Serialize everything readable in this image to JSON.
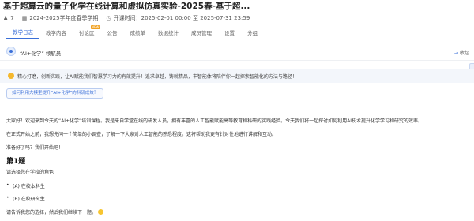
{
  "header": {
    "title": "基于超算云的量子化学在线计算和虚拟仿真实验-2025春-基于超...",
    "members": "7",
    "term": "2024-2025学年度春季学期",
    "start_label": "开课时间",
    "start": "2025-02-01 00:00",
    "to": "至",
    "end": "2025-07-31 23:59"
  },
  "tabs": [
    {
      "label": "教学日志",
      "active": true
    },
    {
      "label": "教学内容"
    },
    {
      "label": "讨论区",
      "badge": "NEW"
    },
    {
      "label": "公告"
    },
    {
      "label": "成绩单"
    },
    {
      "label": "数据统计"
    },
    {
      "label": "成员管理"
    },
    {
      "label": "设置"
    },
    {
      "label": "分组"
    }
  ],
  "assistant": {
    "name": "“AI+化学” 领航员",
    "collapse": "收起"
  },
  "welcome": "精心打磨，创新实践，让AI赋能我们智慧学习力的有效提升！追求卓越，铸就精品，丰智能体将陪伴你一起探索智能化的方法与路径！",
  "question_chip": "如何利用大模型提升“AI+化学”的科研成效？",
  "content": {
    "intro": "大家好！欢迎来到今天的“AI+化学”培训课程。我是来自学堂在线的研发人员，拥有丰富的人工智能赋能高等教育和科研的实践经验。今天我们将一起探讨如何利用AI技术提升化学学习和研究的效率。",
    "intro2": "在正式开始之前，我想先问一个简单的小调查，了解一下大家对人工智能的熟悉程度。这将帮助我更有针对性地进行讲解和互动。",
    "ready": "准备好了吗？我们开始吧！",
    "q_title": "第1题",
    "q_text": "请选择您在学校的角色：",
    "options": [
      "(A) 在校本科生",
      "(B) 在校研究生"
    ],
    "footer": "请告诉我您的选择，然后我们继续下一题。"
  }
}
